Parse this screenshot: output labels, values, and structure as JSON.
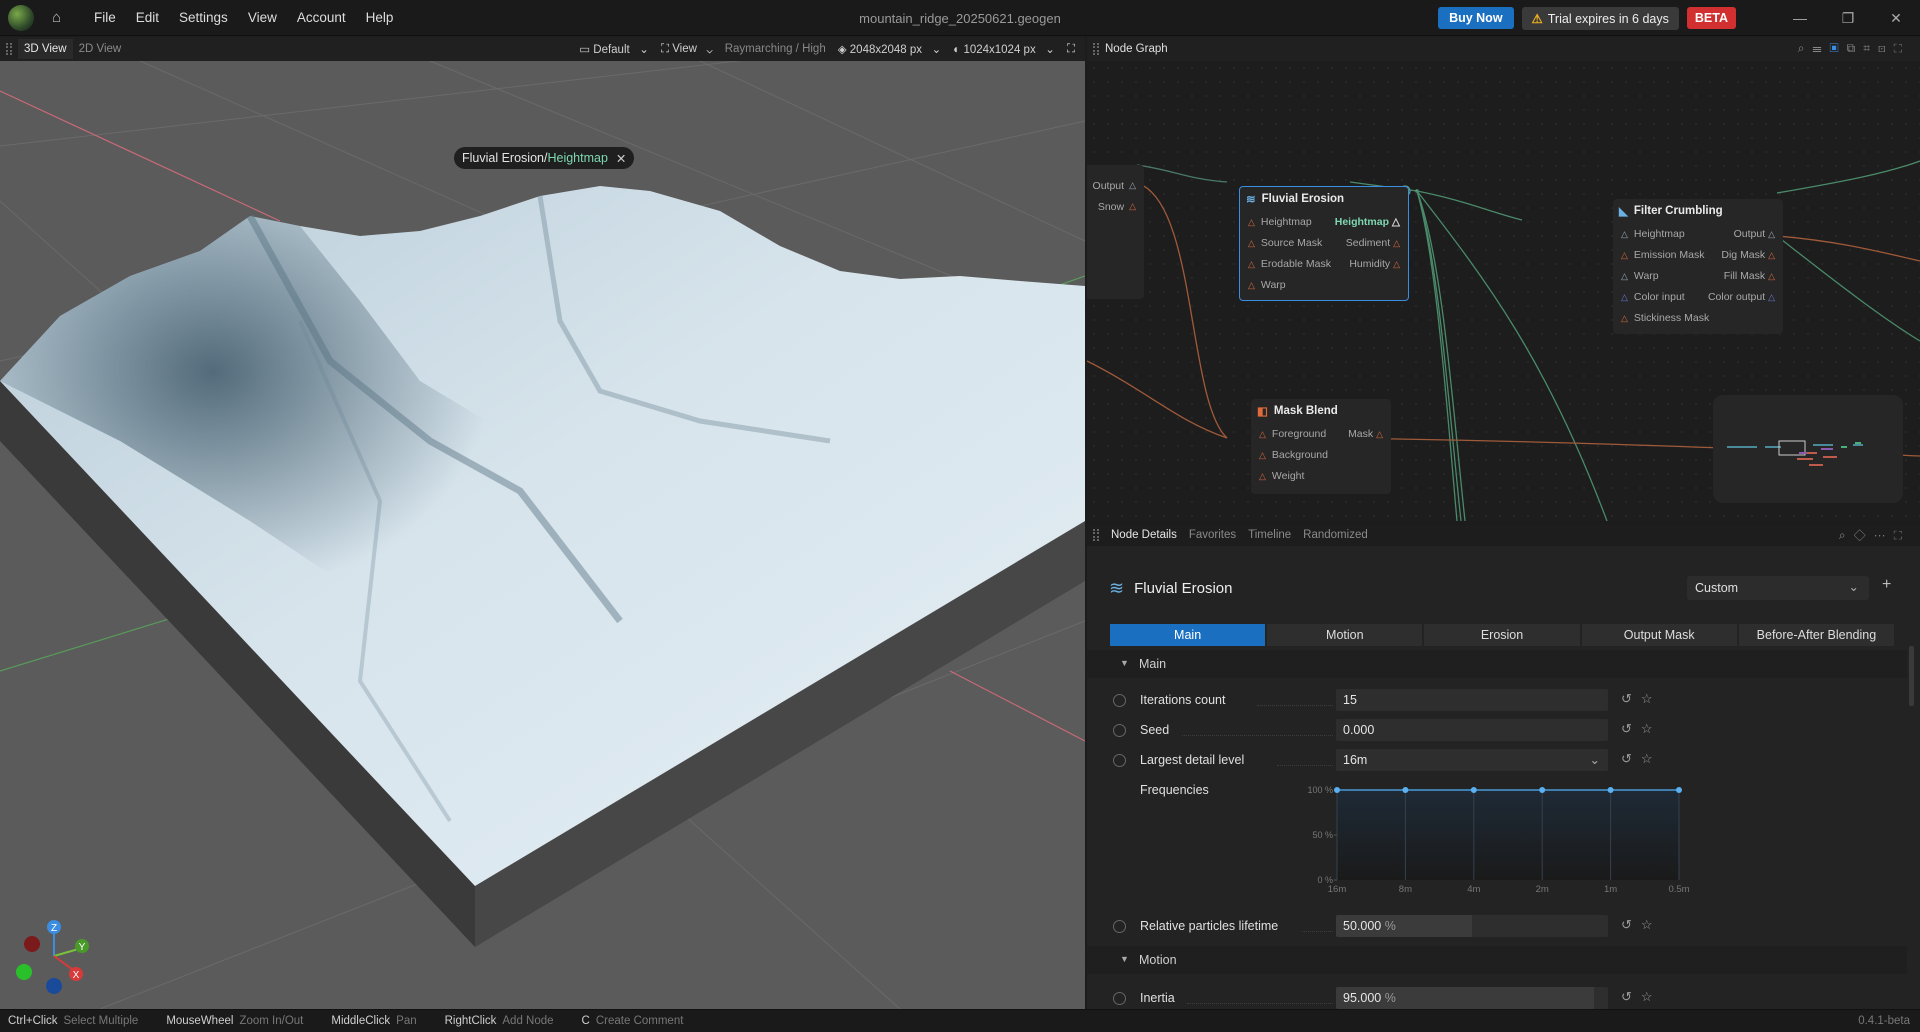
{
  "app": {
    "menu": [
      "File",
      "Edit",
      "Settings",
      "View",
      "Account",
      "Help"
    ],
    "file_title": "mountain_ridge_20250621.geogen",
    "buy_now": "Buy Now",
    "trial": "Trial expires in 6 days",
    "beta": "BETA",
    "window_controls": [
      "minimize-icon",
      "maximize-icon",
      "close-icon"
    ]
  },
  "viewport": {
    "tabs": [
      "3D View",
      "2D View"
    ],
    "preset": "Default",
    "view": "View",
    "render_mode": "Raymarching / High",
    "resolution": "2048x2048 px",
    "texture_resolution": "1024x1024 px",
    "breadcrumb_node": "Fluvial Erosion",
    "breadcrumb_sep": " / ",
    "breadcrumb_output": "Heightmap",
    "axes": {
      "z": "Z",
      "y": "Y",
      "x": "X"
    }
  },
  "graph": {
    "title": "Node Graph",
    "partial_node": {
      "outputs": [
        "Output",
        "Snow"
      ]
    },
    "fluvial": {
      "title": "Fluvial Erosion",
      "inputs": [
        "Heightmap",
        "Source Mask",
        "Erodable Mask",
        "Warp"
      ],
      "outputs": [
        "Heightmap",
        "Sediment",
        "Humidity"
      ]
    },
    "filter": {
      "title": "Filter Crumbling",
      "inputs": [
        "Heightmap",
        "Emission Mask",
        "Warp",
        "Color input",
        "Stickiness Mask"
      ],
      "outputs": [
        "Output",
        "Dig Mask",
        "Fill Mask",
        "Color output"
      ]
    },
    "mask": {
      "title": "Mask Blend",
      "inputs": [
        "Foreground",
        "Background",
        "Weight"
      ],
      "outputs": [
        "Mask"
      ]
    }
  },
  "details": {
    "tabs": [
      "Node Details",
      "Favorites",
      "Timeline",
      "Randomized"
    ],
    "node_title": "Fluvial Erosion",
    "preset": "Custom",
    "subtabs": [
      "Main",
      "Motion",
      "Erosion",
      "Output Mask",
      "Before-After Blending"
    ],
    "active_subtab": "Main",
    "section_main": "Main",
    "section_motion": "Motion",
    "params": {
      "iterations": {
        "label": "Iterations count",
        "value": "15"
      },
      "seed": {
        "label": "Seed",
        "value": "0.000"
      },
      "detail": {
        "label": "Largest detail level",
        "value": "16m"
      },
      "frequencies": {
        "label": "Frequencies"
      },
      "lifetime": {
        "label": "Relative particles lifetime",
        "value": "50.000",
        "unit": "%",
        "fraction": 0.5
      },
      "inertia": {
        "label": "Inertia",
        "value": "95.000",
        "unit": "%",
        "fraction": 0.95
      }
    }
  },
  "chart_data": {
    "type": "line",
    "categories": [
      "16m",
      "8m",
      "4m",
      "2m",
      "1m",
      "0.5m"
    ],
    "values": [
      100,
      100,
      100,
      100,
      100,
      100
    ],
    "y_ticks": [
      "100 %",
      "50 %",
      "0 %"
    ],
    "ylim": [
      0,
      100
    ]
  },
  "statusbar": {
    "hints": [
      {
        "key": "Ctrl+Click",
        "action": "Select Multiple"
      },
      {
        "key": "MouseWheel",
        "action": "Zoom In/Out"
      },
      {
        "key": "MiddleClick",
        "action": "Pan"
      },
      {
        "key": "RightClick",
        "action": "Add Node"
      },
      {
        "key": "C",
        "action": "Create Comment"
      }
    ],
    "version": "0.4.1-beta"
  }
}
